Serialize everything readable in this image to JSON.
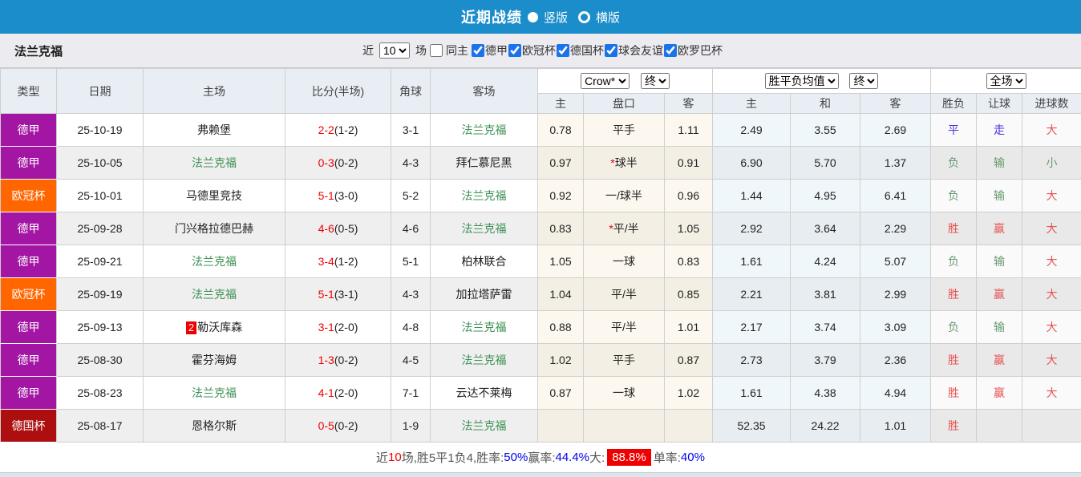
{
  "title_bar": {
    "title": "近期战绩",
    "vertical_label": "竖版",
    "horizontal_label": "横版",
    "bar_color": "#1b8dca"
  },
  "filter_bar": {
    "team_name": "法兰克福",
    "near_label": "近",
    "match_count": "10",
    "games_label": "场",
    "same_home_label": "同主",
    "league_filters": [
      {
        "label": "德甲",
        "checked": true
      },
      {
        "label": "欧冠杯",
        "checked": true
      },
      {
        "label": "德国杯",
        "checked": true
      },
      {
        "label": "球会友谊",
        "checked": true
      },
      {
        "label": "欧罗巴杯",
        "checked": true
      }
    ]
  },
  "table": {
    "columns": {
      "type": "类型",
      "date": "日期",
      "home": "主场",
      "score": "比分(半场)",
      "corner": "角球",
      "away": "客场",
      "asian_home": "主",
      "asian_handicap": "盘口",
      "asian_away": "客",
      "euro_home": "主",
      "euro_draw": "和",
      "euro_away": "客",
      "result": "胜负",
      "handicap_result": "让球",
      "goals": "进球数"
    },
    "selects": {
      "bookmaker": "Crow*",
      "asian_time": "终",
      "euro_type": "胜平负均值",
      "euro_time": "终",
      "scope": "全场"
    },
    "league_colors": {
      "德甲": "#a316a3",
      "欧冠杯": "#ff6600",
      "德国杯": "#ad0f10"
    },
    "rows": [
      {
        "league": "德甲",
        "date": "25-10-19",
        "home": "弗赖堡",
        "home_rank": "",
        "home_green": false,
        "score": "2-2",
        "half": "(1-2)",
        "corner": "3-1",
        "away": "法兰克福",
        "away_rank": "",
        "away_green": true,
        "asian_home": "0.78",
        "handicap": "平手",
        "handicap_star": false,
        "asian_away": "1.11",
        "euro_home": "2.49",
        "euro_draw": "3.55",
        "euro_away": "2.69",
        "result": "平",
        "result_c": "blue",
        "let": "走",
        "let_c": "blue",
        "goals": "大",
        "goals_c": "red"
      },
      {
        "league": "德甲",
        "date": "25-10-05",
        "home": "法兰克福",
        "home_rank": "",
        "home_green": true,
        "score": "0-3",
        "half": "(0-2)",
        "corner": "4-3",
        "away": "拜仁慕尼黑",
        "away_rank": "",
        "away_green": false,
        "asian_home": "0.97",
        "handicap": "球半",
        "handicap_star": true,
        "asian_away": "0.91",
        "euro_home": "6.90",
        "euro_draw": "5.70",
        "euro_away": "1.37",
        "result": "负",
        "result_c": "green",
        "let": "输",
        "let_c": "green",
        "goals": "小",
        "goals_c": "green"
      },
      {
        "league": "欧冠杯",
        "date": "25-10-01",
        "home": "马德里竞技",
        "home_rank": "",
        "home_green": false,
        "score": "5-1",
        "half": "(3-0)",
        "corner": "5-2",
        "away": "法兰克福",
        "away_rank": "",
        "away_green": true,
        "asian_home": "0.92",
        "handicap": "一/球半",
        "handicap_star": false,
        "asian_away": "0.96",
        "euro_home": "1.44",
        "euro_draw": "4.95",
        "euro_away": "6.41",
        "result": "负",
        "result_c": "green",
        "let": "输",
        "let_c": "green",
        "goals": "大",
        "goals_c": "red"
      },
      {
        "league": "德甲",
        "date": "25-09-28",
        "home": "门兴格拉德巴赫",
        "home_rank": "",
        "home_green": false,
        "score": "4-6",
        "half": "(0-5)",
        "corner": "4-6",
        "away": "法兰克福",
        "away_rank": "",
        "away_green": true,
        "asian_home": "0.83",
        "handicap": "平/半",
        "handicap_star": true,
        "asian_away": "1.05",
        "euro_home": "2.92",
        "euro_draw": "3.64",
        "euro_away": "2.29",
        "result": "胜",
        "result_c": "red",
        "let": "赢",
        "let_c": "red",
        "goals": "大",
        "goals_c": "red"
      },
      {
        "league": "德甲",
        "date": "25-09-21",
        "home": "法兰克福",
        "home_rank": "",
        "home_green": true,
        "score": "3-4",
        "half": "(1-2)",
        "corner": "5-1",
        "away": "柏林联合",
        "away_rank": "",
        "away_green": false,
        "asian_home": "1.05",
        "handicap": "一球",
        "handicap_star": false,
        "asian_away": "0.83",
        "euro_home": "1.61",
        "euro_draw": "4.24",
        "euro_away": "5.07",
        "result": "负",
        "result_c": "green",
        "let": "输",
        "let_c": "green",
        "goals": "大",
        "goals_c": "red"
      },
      {
        "league": "欧冠杯",
        "date": "25-09-19",
        "home": "法兰克福",
        "home_rank": "",
        "home_green": true,
        "score": "5-1",
        "half": "(3-1)",
        "corner": "4-3",
        "away": "加拉塔萨雷",
        "away_rank": "",
        "away_green": false,
        "asian_home": "1.04",
        "handicap": "平/半",
        "handicap_star": false,
        "asian_away": "0.85",
        "euro_home": "2.21",
        "euro_draw": "3.81",
        "euro_away": "2.99",
        "result": "胜",
        "result_c": "red",
        "let": "赢",
        "let_c": "red",
        "goals": "大",
        "goals_c": "red"
      },
      {
        "league": "德甲",
        "date": "25-09-13",
        "home": "勒沃库森",
        "home_rank": "2",
        "home_green": false,
        "score": "3-1",
        "half": "(2-0)",
        "corner": "4-8",
        "away": "法兰克福",
        "away_rank": "",
        "away_green": true,
        "asian_home": "0.88",
        "handicap": "平/半",
        "handicap_star": false,
        "asian_away": "1.01",
        "euro_home": "2.17",
        "euro_draw": "3.74",
        "euro_away": "3.09",
        "result": "负",
        "result_c": "green",
        "let": "输",
        "let_c": "green",
        "goals": "大",
        "goals_c": "red"
      },
      {
        "league": "德甲",
        "date": "25-08-30",
        "home": "霍芬海姆",
        "home_rank": "",
        "home_green": false,
        "score": "1-3",
        "half": "(0-2)",
        "corner": "4-5",
        "away": "法兰克福",
        "away_rank": "",
        "away_green": true,
        "asian_home": "1.02",
        "handicap": "平手",
        "handicap_star": false,
        "asian_away": "0.87",
        "euro_home": "2.73",
        "euro_draw": "3.79",
        "euro_away": "2.36",
        "result": "胜",
        "result_c": "red",
        "let": "赢",
        "let_c": "red",
        "goals": "大",
        "goals_c": "red"
      },
      {
        "league": "德甲",
        "date": "25-08-23",
        "home": "法兰克福",
        "home_rank": "",
        "home_green": true,
        "score": "4-1",
        "half": "(2-0)",
        "corner": "7-1",
        "away": "云达不莱梅",
        "away_rank": "",
        "away_green": false,
        "asian_home": "0.87",
        "handicap": "一球",
        "handicap_star": false,
        "asian_away": "1.02",
        "euro_home": "1.61",
        "euro_draw": "4.38",
        "euro_away": "4.94",
        "result": "胜",
        "result_c": "red",
        "let": "赢",
        "let_c": "red",
        "goals": "大",
        "goals_c": "red"
      },
      {
        "league": "德国杯",
        "date": "25-08-17",
        "home": "恩格尔斯",
        "home_rank": "",
        "home_green": false,
        "score": "0-5",
        "half": "(0-2)",
        "corner": "1-9",
        "away": "法兰克福",
        "away_rank": "",
        "away_green": true,
        "asian_home": "",
        "handicap": "",
        "handicap_star": false,
        "asian_away": "",
        "euro_home": "52.35",
        "euro_draw": "24.22",
        "euro_away": "1.01",
        "result": "胜",
        "result_c": "red",
        "let": "",
        "let_c": "",
        "goals": "",
        "goals_c": ""
      }
    ]
  },
  "footer": {
    "segments": [
      {
        "text": "近",
        "c": "dark"
      },
      {
        "text": "10",
        "c": "red"
      },
      {
        "text": "场,胜5平1负4, ",
        "c": "dark"
      },
      {
        "text": "胜率:",
        "c": "dark"
      },
      {
        "text": "50%",
        "c": "blue"
      },
      {
        "text": " 赢率:",
        "c": "dark"
      },
      {
        "text": "44.4%",
        "c": "blue"
      },
      {
        "text": " 大:",
        "c": "dark"
      },
      {
        "text": "88.8%",
        "c": "badge"
      },
      {
        "text": " 单率:",
        "c": "dark"
      },
      {
        "text": "40%",
        "c": "blue"
      }
    ]
  },
  "colors": {
    "result_red": "#e85252",
    "result_green": "#68996f",
    "result_blue": "#4433dd",
    "score_red": "#ee0000",
    "frankfurt_green": "#3d9155"
  }
}
